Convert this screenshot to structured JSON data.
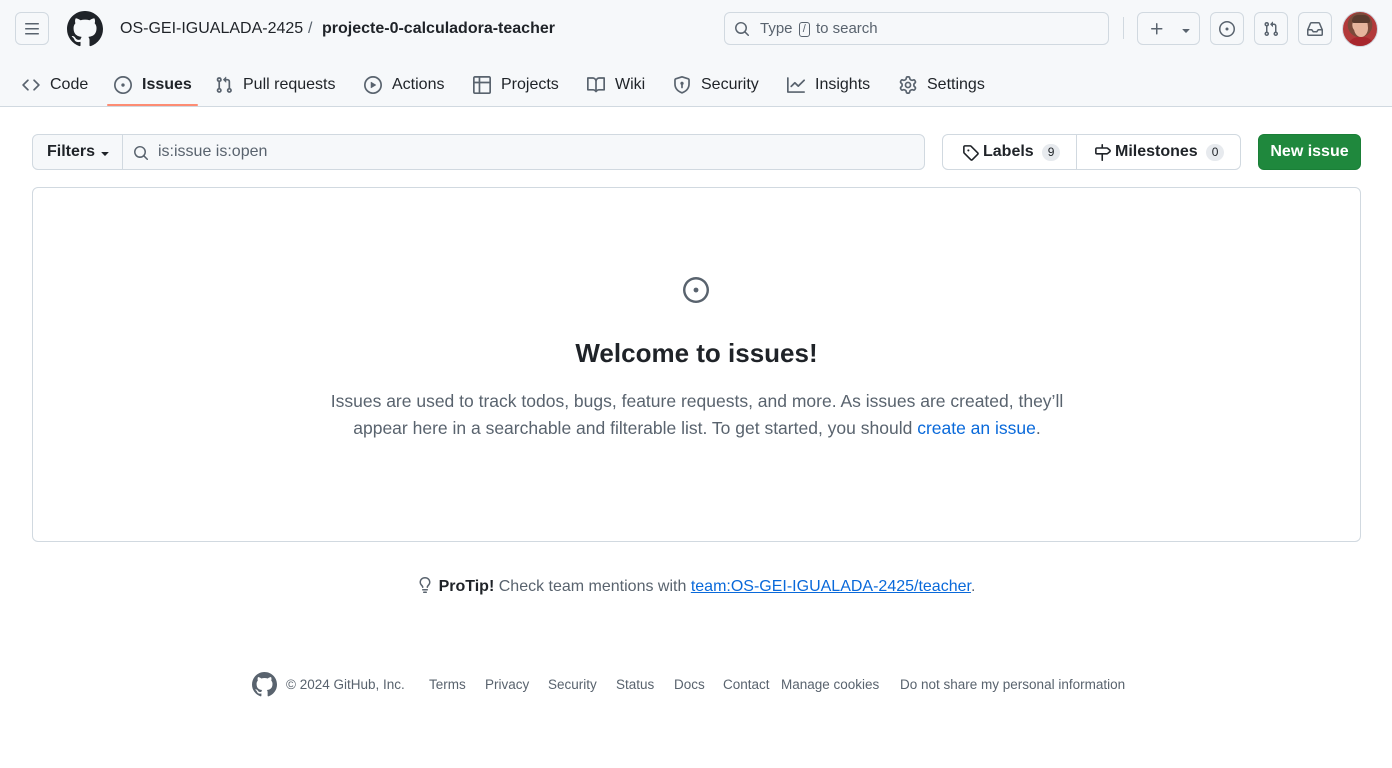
{
  "header": {
    "owner": "OS-GEI-IGUALADA-2425",
    "separator": "/",
    "repo": "projecte-0-calculadora-teacher",
    "search_prefix": "Type",
    "search_key": "/",
    "search_suffix": "to search"
  },
  "nav": {
    "tabs": [
      {
        "label": "Code",
        "icon": "code-icon"
      },
      {
        "label": "Issues",
        "icon": "issue-opened-icon",
        "selected": true
      },
      {
        "label": "Pull requests",
        "icon": "git-pull-request-icon"
      },
      {
        "label": "Actions",
        "icon": "play-icon"
      },
      {
        "label": "Projects",
        "icon": "table-icon"
      },
      {
        "label": "Wiki",
        "icon": "book-icon"
      },
      {
        "label": "Security",
        "icon": "shield-icon"
      },
      {
        "label": "Insights",
        "icon": "graph-icon"
      },
      {
        "label": "Settings",
        "icon": "gear-icon"
      }
    ]
  },
  "toolbar": {
    "filters_label": "Filters",
    "query_value": "is:issue is:open",
    "labels_label": "Labels",
    "labels_count": "9",
    "milestones_label": "Milestones",
    "milestones_count": "0",
    "new_issue_label": "New issue"
  },
  "blankslate": {
    "title": "Welcome to issues!",
    "description": "Issues are used to track todos, bugs, feature requests, and more. As issues are created, they’ll appear here in a searchable and filterable list. To get started, you should",
    "link_text": "create an issue",
    "end": "."
  },
  "protip": {
    "label": "ProTip!",
    "text": "Check team mentions with",
    "link_text": "team:OS-GEI-IGUALADA-2425/teacher",
    "end": "."
  },
  "footer": {
    "copyright": "© 2024 GitHub, Inc.",
    "links": [
      "Terms",
      "Privacy",
      "Security",
      "Status",
      "Docs",
      "Contact",
      "Manage cookies",
      "Do not share my personal information"
    ]
  },
  "colors": {
    "primary_button": "#1f883d",
    "link": "#0969da",
    "tab_underline": "#fd8c73"
  }
}
